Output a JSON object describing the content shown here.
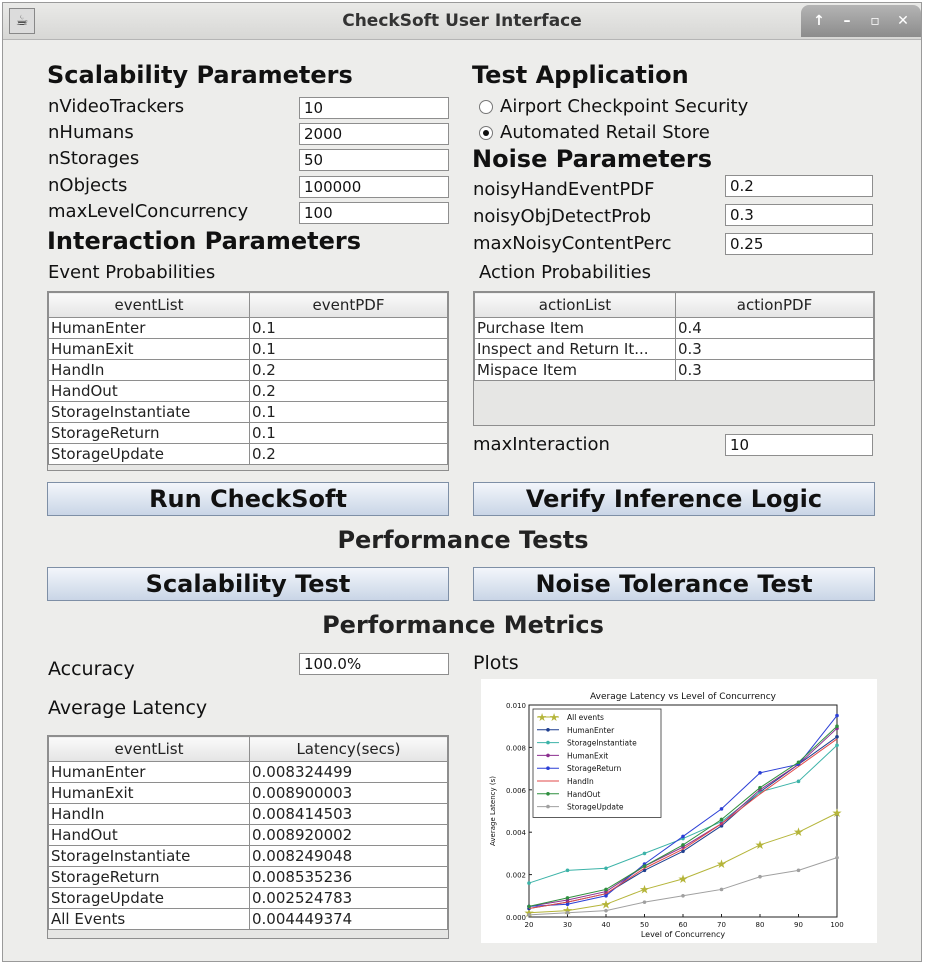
{
  "window": {
    "title": "CheckSoft User Interface"
  },
  "scalability": {
    "heading": "Scalability Parameters",
    "fields": [
      {
        "label": "nVideoTrackers",
        "value": "10"
      },
      {
        "label": "nHumans",
        "value": "2000"
      },
      {
        "label": "nStorages",
        "value": "50"
      },
      {
        "label": "nObjects",
        "value": "100000"
      },
      {
        "label": "maxLevelConcurrency",
        "value": "100"
      }
    ]
  },
  "test_app": {
    "heading": "Test Application",
    "options": [
      {
        "label": "Airport Checkpoint Security",
        "selected": false
      },
      {
        "label": "Automated Retail Store",
        "selected": true
      }
    ]
  },
  "noise": {
    "heading": "Noise Parameters",
    "fields": [
      {
        "label": "noisyHandEventPDF",
        "value": "0.2"
      },
      {
        "label": "noisyObjDetectProb",
        "value": "0.3"
      },
      {
        "label": "maxNoisyContentPerc",
        "value": "0.25"
      }
    ]
  },
  "interaction": {
    "heading": "Interaction Parameters",
    "event_title": "Event Probabilities",
    "event_headers": [
      "eventList",
      "eventPDF"
    ],
    "event_rows": [
      [
        "HumanEnter",
        "0.1"
      ],
      [
        "HumanExit",
        "0.1"
      ],
      [
        "HandIn",
        "0.2"
      ],
      [
        "HandOut",
        "0.2"
      ],
      [
        "StorageInstantiate",
        "0.1"
      ],
      [
        "StorageReturn",
        "0.1"
      ],
      [
        "StorageUpdate",
        "0.2"
      ]
    ],
    "action_title": "Action Probabilities",
    "action_headers": [
      "actionList",
      "actionPDF"
    ],
    "action_rows": [
      [
        "Purchase Item",
        "0.4"
      ],
      [
        "Inspect and Return It...",
        "0.3"
      ],
      [
        "Mispace Item",
        "0.3"
      ]
    ],
    "max_interaction_label": "maxInteraction",
    "max_interaction_value": "10"
  },
  "buttons": {
    "run": "Run CheckSoft",
    "verify": "Verify Inference Logic",
    "scal": "Scalability Test",
    "noise": "Noise Tolerance Test"
  },
  "perf_tests_heading": "Performance Tests",
  "metrics": {
    "heading": "Performance Metrics",
    "accuracy_label": "Accuracy",
    "accuracy_value": "100.0%",
    "latency_title": "Average Latency",
    "plots_label": "Plots",
    "latency_headers": [
      "eventList",
      "Latency(secs)"
    ],
    "latency_rows": [
      [
        "HumanEnter",
        "0.008324499"
      ],
      [
        "HumanExit",
        "0.008900003"
      ],
      [
        "HandIn",
        "0.008414503"
      ],
      [
        "HandOut",
        "0.008920002"
      ],
      [
        "StorageInstantiate",
        "0.008249048"
      ],
      [
        "StorageReturn",
        "0.008535236"
      ],
      [
        "StorageUpdate",
        "0.002524783"
      ],
      [
        "All Events",
        "0.004449374"
      ]
    ]
  },
  "chart_data": {
    "type": "line",
    "title": "Average Latency vs Level of Concurrency",
    "xlabel": "Level of Concurrency",
    "ylabel": "Average Latency (s)",
    "x": [
      20,
      30,
      40,
      50,
      60,
      70,
      80,
      90,
      100
    ],
    "xlim": [
      20,
      100
    ],
    "ylim": [
      0,
      0.01
    ],
    "xticks": [
      "20",
      "30",
      "40",
      "50",
      "60",
      "70",
      "80",
      "90",
      "100"
    ],
    "yticks": [
      "0.000",
      "0.002",
      "0.004",
      "0.006",
      "0.008",
      "0.010"
    ],
    "legend": "top-left",
    "series": [
      {
        "name": "All events",
        "color": "#b5b53a",
        "marker": "star",
        "values": [
          0.0002,
          0.0003,
          0.0006,
          0.0013,
          0.0018,
          0.0025,
          0.0034,
          0.004,
          0.0049
        ]
      },
      {
        "name": "HumanEnter",
        "color": "#1f3f8f",
        "marker": "dot",
        "values": [
          0.0004,
          0.0007,
          0.0011,
          0.0022,
          0.0031,
          0.0043,
          0.0059,
          0.0072,
          0.0085
        ]
      },
      {
        "name": "StorageInstantiate",
        "color": "#3cb3a8",
        "marker": "dot",
        "values": [
          0.0016,
          0.0022,
          0.0023,
          0.003,
          0.0037,
          0.0045,
          0.0059,
          0.0064,
          0.0081
        ]
      },
      {
        "name": "HumanExit",
        "color": "#8b2f8f",
        "marker": "dot",
        "values": [
          0.0005,
          0.0008,
          0.0012,
          0.0024,
          0.0033,
          0.0044,
          0.006,
          0.0072,
          0.0089
        ]
      },
      {
        "name": "StorageReturn",
        "color": "#2b3fd6",
        "marker": "dot",
        "values": [
          0.0005,
          0.0006,
          0.001,
          0.0025,
          0.0038,
          0.0051,
          0.0068,
          0.0072,
          0.0095
        ]
      },
      {
        "name": "HandIn",
        "color": "#e24a4a",
        "marker": "none",
        "values": [
          0.0004,
          0.0007,
          0.0011,
          0.0023,
          0.0032,
          0.0044,
          0.0058,
          0.0071,
          0.0084
        ]
      },
      {
        "name": "HandOut",
        "color": "#2f8f3f",
        "marker": "dot",
        "values": [
          0.0005,
          0.0009,
          0.0013,
          0.0024,
          0.0034,
          0.0046,
          0.0061,
          0.0073,
          0.009
        ]
      },
      {
        "name": "StorageUpdate",
        "color": "#a0a0a0",
        "marker": "dot",
        "values": [
          0.0001,
          0.0002,
          0.0003,
          0.0007,
          0.001,
          0.0013,
          0.0019,
          0.0022,
          0.0028
        ]
      }
    ]
  }
}
